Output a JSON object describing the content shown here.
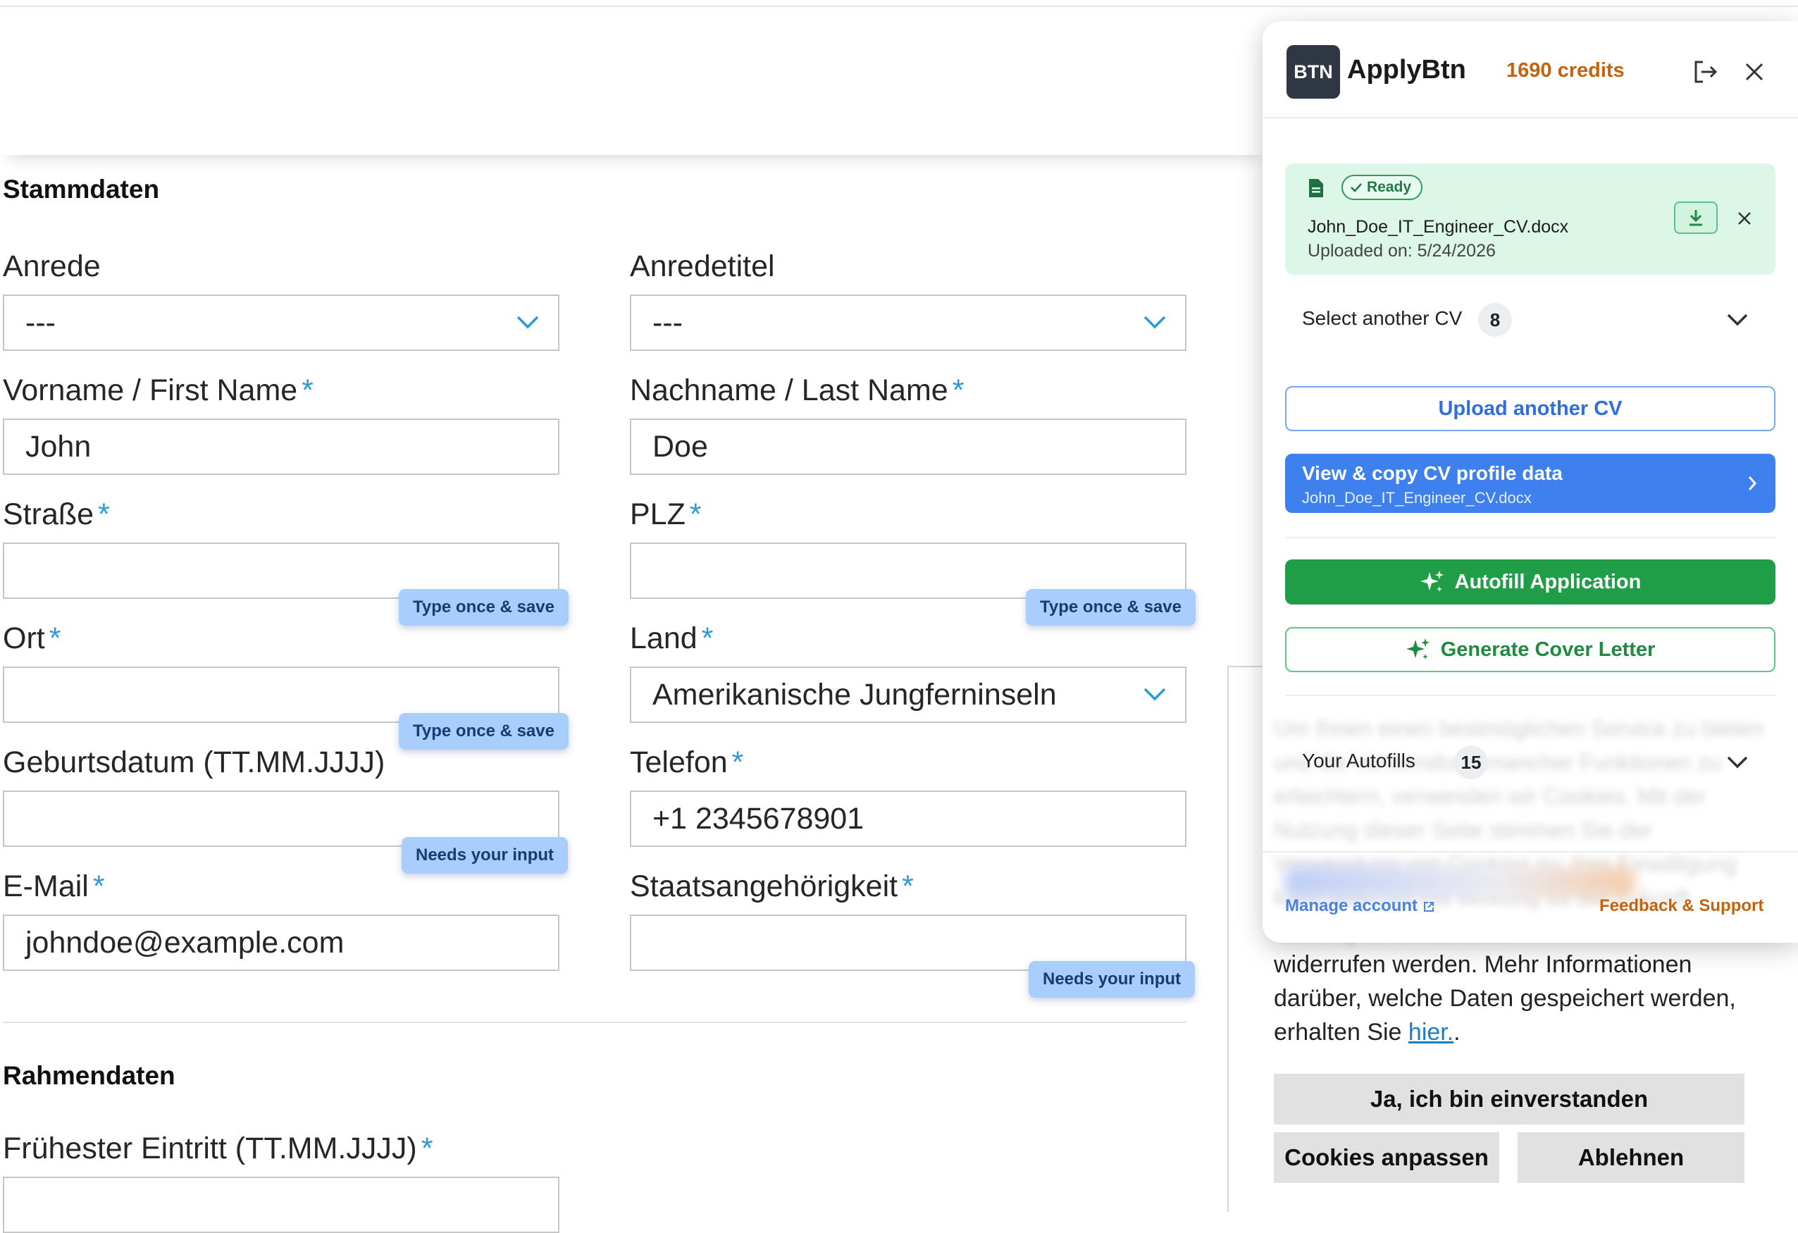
{
  "form": {
    "section_stammdaten": "Stammdaten",
    "section_rahmendaten": "Rahmendaten",
    "anrede": {
      "label": "Anrede",
      "value": "---"
    },
    "anredetitel": {
      "label": "Anredetitel",
      "value": "---"
    },
    "vorname": {
      "label": "Vorname / First Name",
      "value": "John"
    },
    "nachname": {
      "label": "Nachname / Last Name",
      "value": "Doe"
    },
    "strasse": {
      "label": "Straße",
      "value": "",
      "hint": "Type once & save"
    },
    "plz": {
      "label": "PLZ",
      "value": "",
      "hint": "Type once & save"
    },
    "ort": {
      "label": "Ort",
      "value": "",
      "hint": "Type once & save"
    },
    "land": {
      "label": "Land",
      "value": "Amerikanische Jungferninseln"
    },
    "geburtsdatum": {
      "label": "Geburtsdatum (TT.MM.JJJJ)",
      "value": "",
      "hint": "Needs your input"
    },
    "telefon": {
      "label": "Telefon",
      "value": "+1 2345678901"
    },
    "email": {
      "label": "E-Mail",
      "value": "johndoe@example.com"
    },
    "staatsangehoerigkeit": {
      "label": "Staatsangehörigkeit",
      "value": "",
      "hint": "Needs your input"
    },
    "eintritt": {
      "label": "Frühester Eintritt (TT.MM.JJJJ)",
      "value": ""
    },
    "required_mark": "*"
  },
  "cookie": {
    "text_before_link": "widerrufen werden. Mehr Informationen darüber, welche Daten gespeichert werden, erhalten Sie ",
    "link": "hier.",
    "text_after_link": ".",
    "blurred_text": "Um Ihnen einen bestmöglichen Service zu bieten und die Verwendung mancher Funktionen zu erleichtern, verwenden wir Cookies. Mit der Nutzung dieser Seite stimmen Sie der Verwendung von Cookies zu. Ihre Einwilligung kann jederzeit mit Wirkung für die Zukunft",
    "accept": "Ja, ich bin einverstanden",
    "customize": "Cookies anpassen",
    "decline": "Ablehnen"
  },
  "popup": {
    "logo": "BTN",
    "title": "ApplyBtn",
    "credits": "1690 credits",
    "cv": {
      "status": "Ready",
      "filename": "John_Doe_IT_Engineer_CV.docx",
      "uploaded": "Uploaded on: 5/24/2026"
    },
    "select_cv": {
      "label": "Select another CV",
      "count": "8"
    },
    "upload_button": "Upload another CV",
    "view_button": {
      "title": "View & copy CV profile data",
      "subtitle": "John_Doe_IT_Engineer_CV.docx"
    },
    "autofill_button": "Autofill Application",
    "cover_letter_button": "Generate Cover Letter",
    "autofills": {
      "label": "Your Autofills",
      "count": "15"
    },
    "manage_account": "Manage account",
    "feedback": "Feedback & Support"
  },
  "colors": {
    "accent_blue": "#3f80ef",
    "accent_green": "#1f9d47",
    "credits_orange": "#c4630f",
    "chip_blue": "#a9cdfd",
    "required_blue": "#2a9bd6"
  }
}
